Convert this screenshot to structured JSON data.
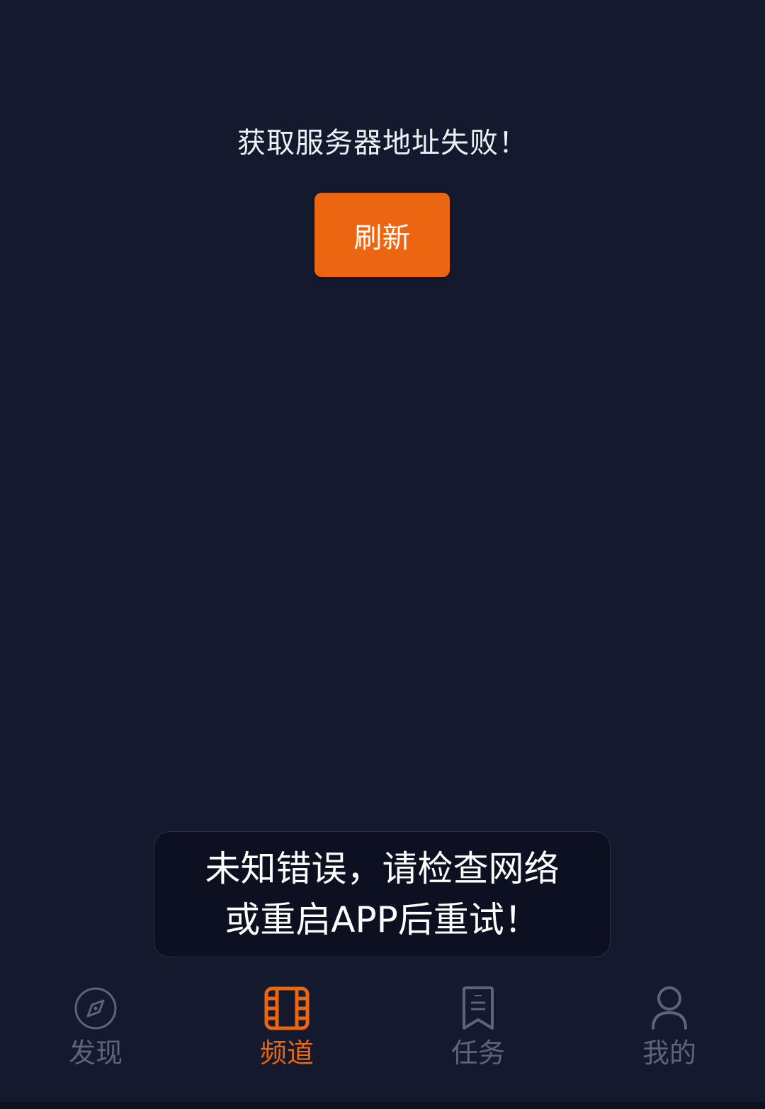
{
  "status": {
    "error_text": "获取服务器地址失败！",
    "refresh_label": "刷新"
  },
  "toast": {
    "line1": "未知错误，请检查网络",
    "line2": "或重启APP后重试！"
  },
  "tabs": [
    {
      "label": "发现",
      "icon": "compass-icon",
      "active": false
    },
    {
      "label": "频道",
      "icon": "film-icon",
      "active": true
    },
    {
      "label": "任务",
      "icon": "bookmark-icon",
      "active": false
    },
    {
      "label": "我的",
      "icon": "user-icon",
      "active": false
    }
  ],
  "colors": {
    "background": "#141a2e",
    "accent": "#ec6510",
    "inactive": "#5d6477"
  }
}
